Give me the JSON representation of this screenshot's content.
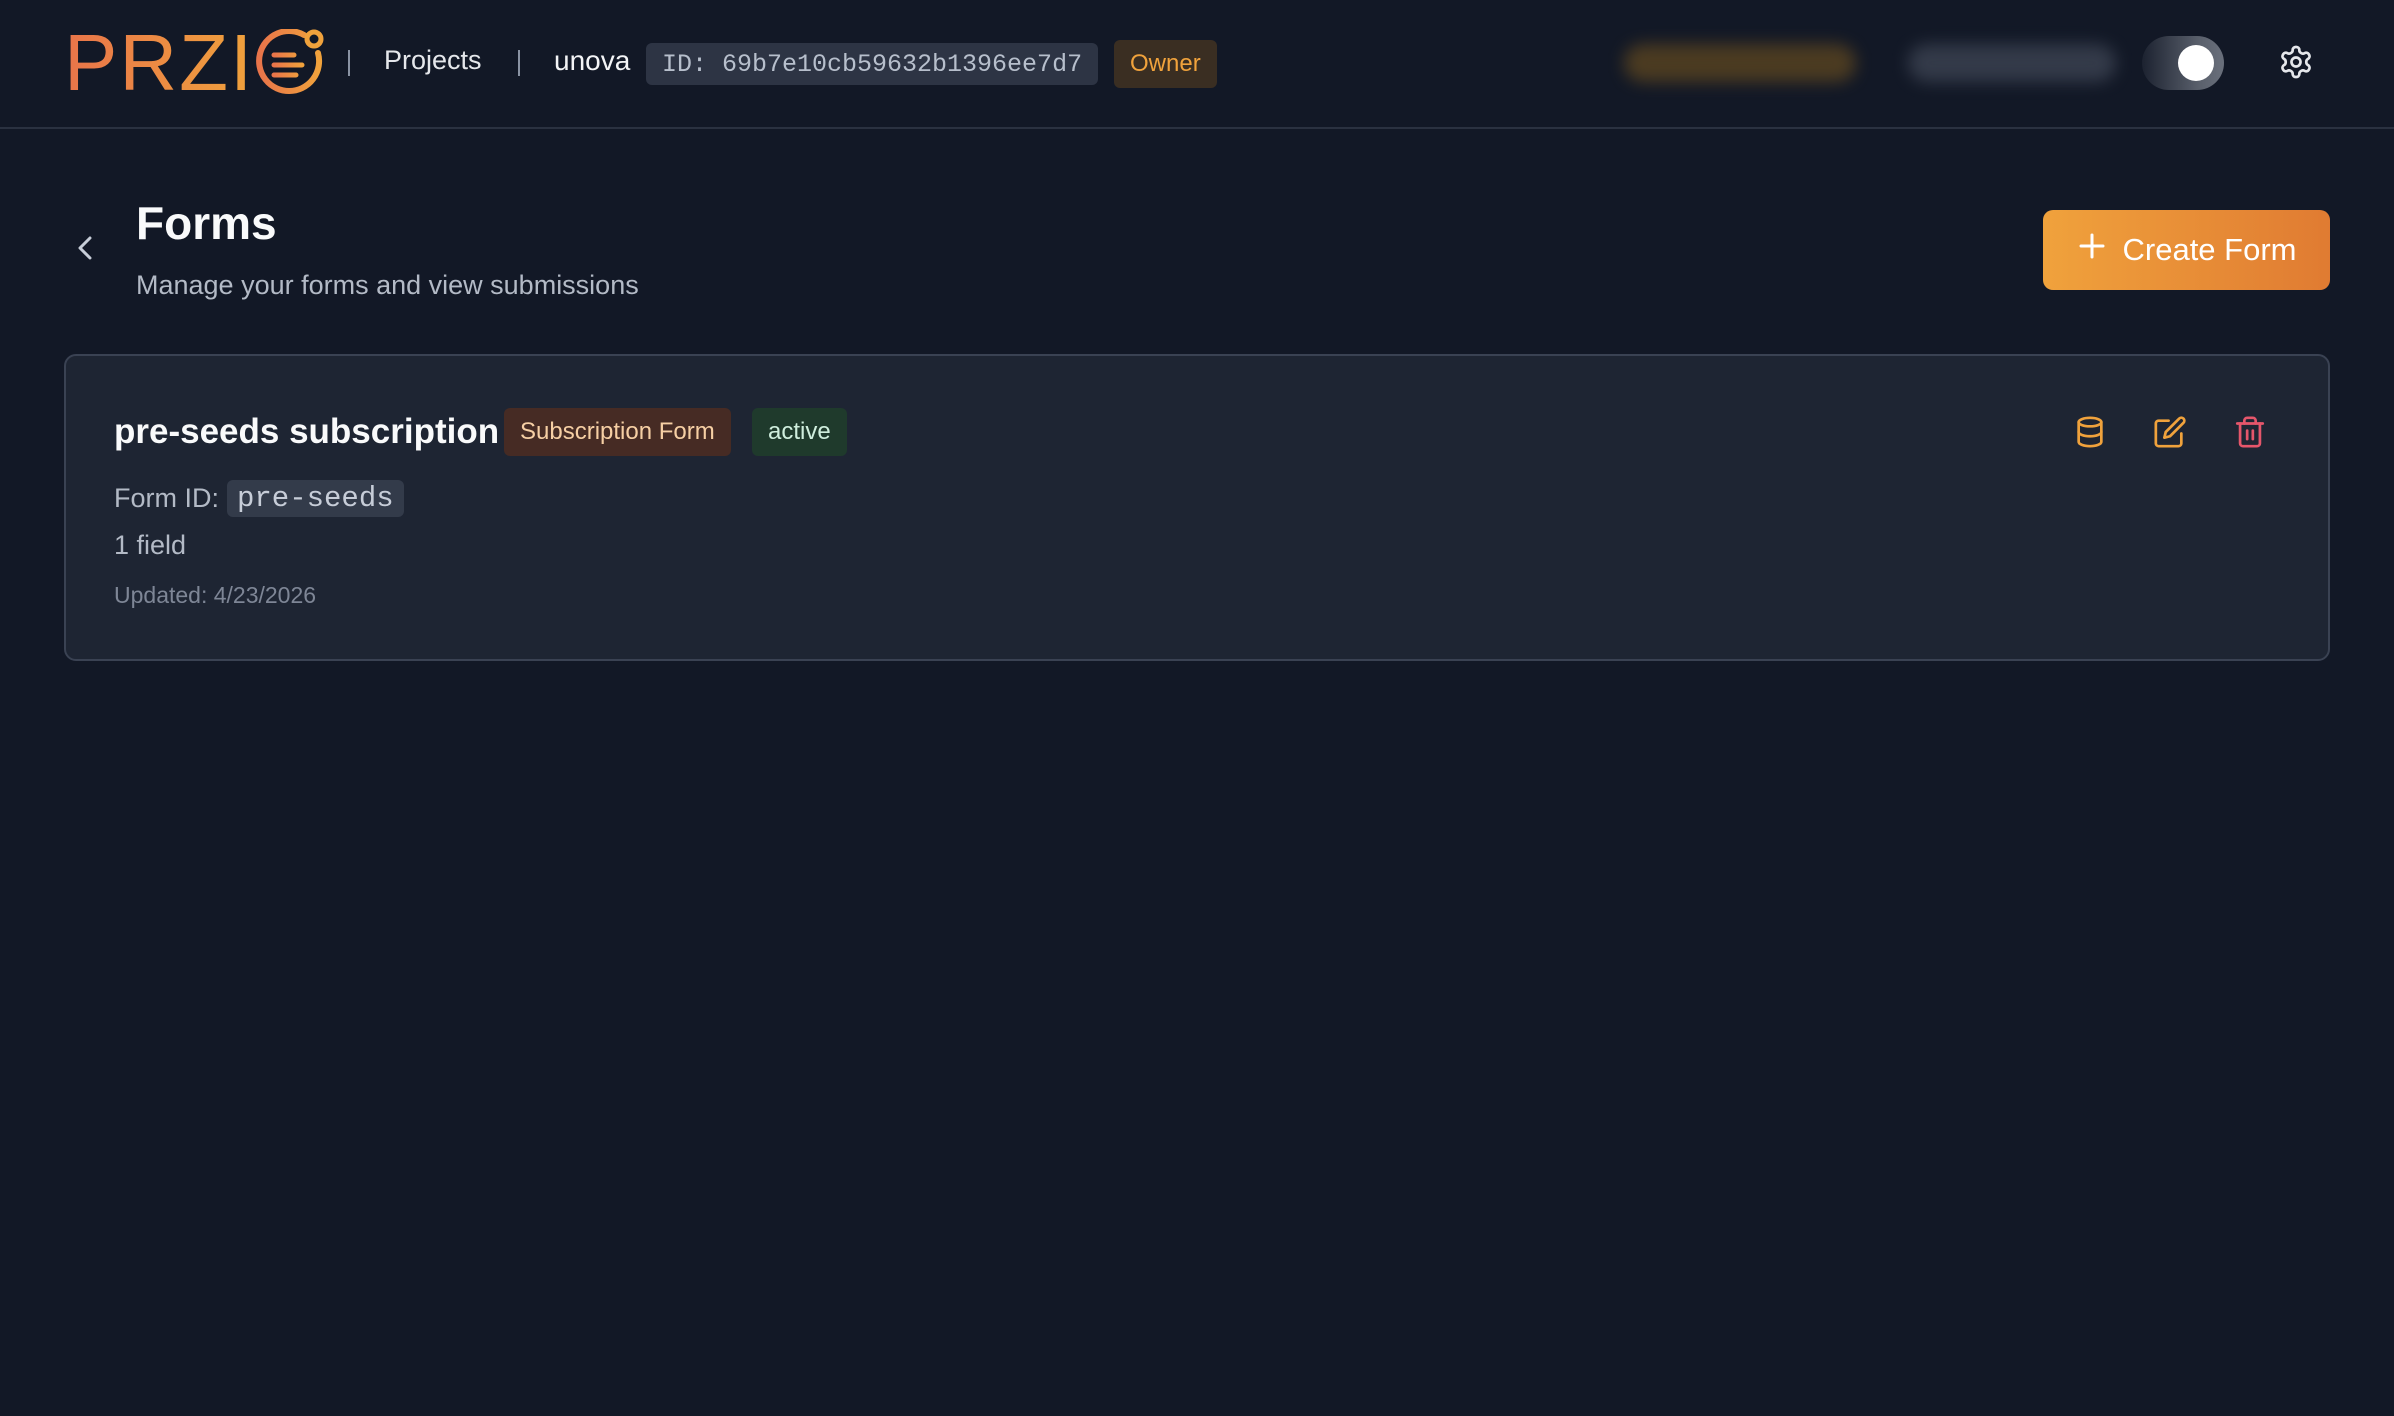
{
  "header": {
    "logo_text": "PRZI",
    "nav_projects": "Projects",
    "project_name": "unova",
    "project_id": "ID: 69b7e10cb59632b1396ee7d7",
    "role": "Owner"
  },
  "page": {
    "title": "Forms",
    "subtitle": "Manage your forms and view submissions",
    "create_label": "Create Form"
  },
  "forms": [
    {
      "title": "pre-seeds subscription",
      "type_badge": "Subscription Form",
      "status_badge": "active",
      "form_id_label": "Form ID:",
      "form_id": "pre-seeds",
      "fields": "1 field",
      "updated": "Updated: 4/23/2026"
    }
  ],
  "icons": {
    "back": "chevron-left-icon",
    "settings": "gear-icon",
    "create": "plus-icon",
    "submissions": "database-icon",
    "edit": "edit-icon",
    "delete": "trash-icon"
  },
  "colors": {
    "background": "#121826",
    "accent": "#f0a23c",
    "card": "#1e2533",
    "danger": "#e5566b"
  }
}
